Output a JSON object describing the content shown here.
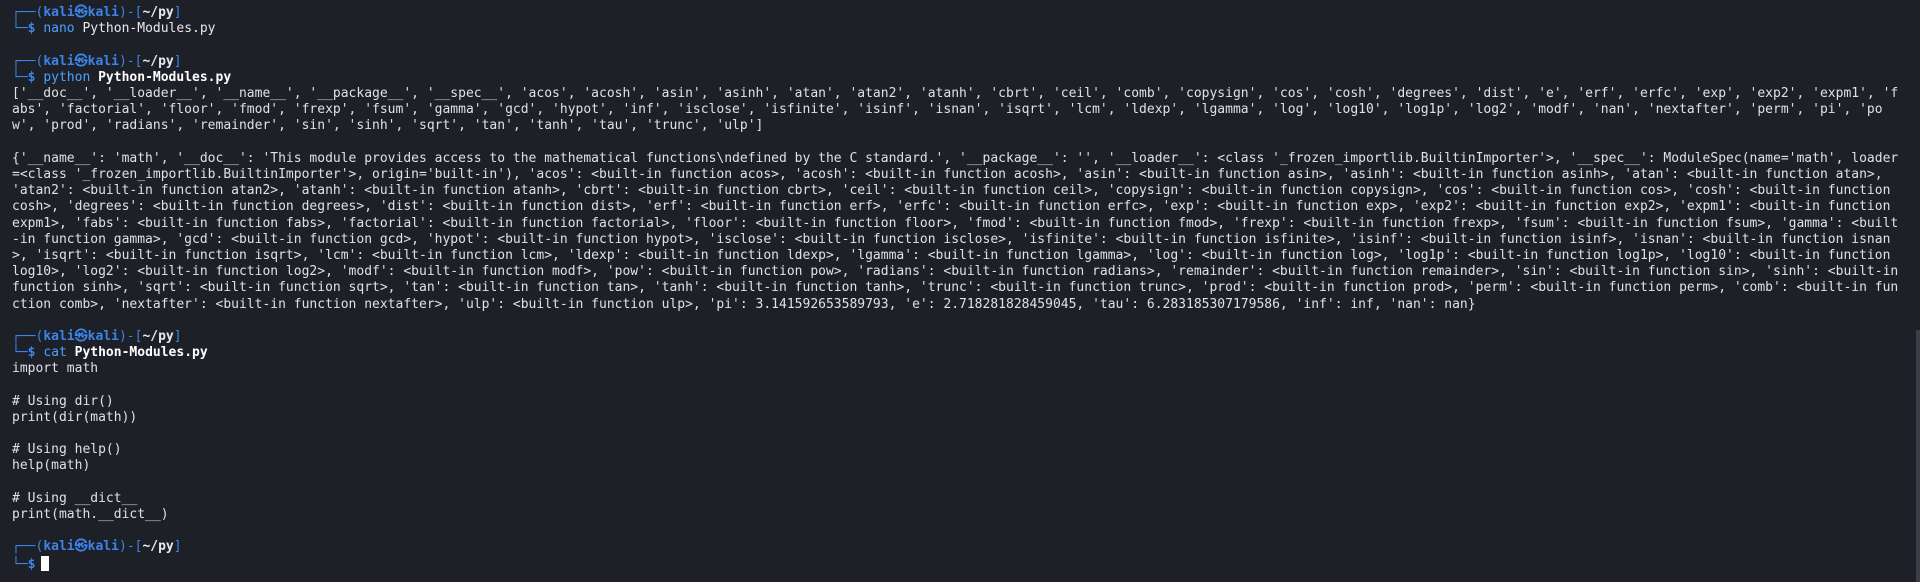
{
  "prompt": {
    "frame_top_open": "┌──(",
    "user": "kali",
    "at": "㉿",
    "host": "kali",
    "frame_mid": ")-[",
    "cwd": "~/py",
    "frame_close": "]",
    "frame_bottom": "└─",
    "dollar": "$"
  },
  "commands": [
    {
      "cmd": "nano",
      "arg": "Python-Modules.py"
    },
    {
      "cmd": "python",
      "arg": "Python-Modules.py"
    },
    {
      "cmd": "cat",
      "arg": "Python-Modules.py"
    }
  ],
  "output": {
    "dir_output": "['__doc__', '__loader__', '__name__', '__package__', '__spec__', 'acos', 'acosh', 'asin', 'asinh', 'atan', 'atan2', 'atanh', 'cbrt', 'ceil', 'comb', 'copysign', 'cos', 'cosh', 'degrees', 'dist', 'e', 'erf', 'erfc', 'exp', 'exp2', 'expm1', 'fabs', 'factorial', 'floor', 'fmod', 'frexp', 'fsum', 'gamma', 'gcd', 'hypot', 'inf', 'isclose', 'isfinite', 'isinf', 'isnan', 'isqrt', 'lcm', 'ldexp', 'lgamma', 'log', 'log10', 'log1p', 'log2', 'modf', 'nan', 'nextafter', 'perm', 'pi', 'pow', 'prod', 'radians', 'remainder', 'sin', 'sinh', 'sqrt', 'tan', 'tanh', 'tau', 'trunc', 'ulp']",
    "dict_output": "{'__name__': 'math', '__doc__': 'This module provides access to the mathematical functions\\ndefined by the C standard.', '__package__': '', '__loader__': <class '_frozen_importlib.BuiltinImporter'>, '__spec__': ModuleSpec(name='math', loader=<class '_frozen_importlib.BuiltinImporter'>, origin='built-in'), 'acos': <built-in function acos>, 'acosh': <built-in function acosh>, 'asin': <built-in function asin>, 'asinh': <built-in function asinh>, 'atan': <built-in function atan>, 'atan2': <built-in function atan2>, 'atanh': <built-in function atanh>, 'cbrt': <built-in function cbrt>, 'ceil': <built-in function ceil>, 'copysign': <built-in function copysign>, 'cos': <built-in function cos>, 'cosh': <built-in function cosh>, 'degrees': <built-in function degrees>, 'dist': <built-in function dist>, 'erf': <built-in function erf>, 'erfc': <built-in function erfc>, 'exp': <built-in function exp>, 'exp2': <built-in function exp2>, 'expm1': <built-in function expm1>, 'fabs': <built-in function fabs>, 'factorial': <built-in function factorial>, 'floor': <built-in function floor>, 'fmod': <built-in function fmod>, 'frexp': <built-in function frexp>, 'fsum': <built-in function fsum>, 'gamma': <built-in function gamma>, 'gcd': <built-in function gcd>, 'hypot': <built-in function hypot>, 'isclose': <built-in function isclose>, 'isfinite': <built-in function isfinite>, 'isinf': <built-in function isinf>, 'isnan': <built-in function isnan>, 'isqrt': <built-in function isqrt>, 'lcm': <built-in function lcm>, 'ldexp': <built-in function ldexp>, 'lgamma': <built-in function lgamma>, 'log': <built-in function log>, 'log1p': <built-in function log1p>, 'log10': <built-in function log10>, 'log2': <built-in function log2>, 'modf': <built-in function modf>, 'pow': <built-in function pow>, 'radians': <built-in function radians>, 'remainder': <built-in function remainder>, 'sin': <built-in function sin>, 'sinh': <built-in function sinh>, 'sqrt': <built-in function sqrt>, 'tan': <built-in function tan>, 'tanh': <built-in function tanh>, 'trunc': <built-in function trunc>, 'prod': <built-in function prod>, 'perm': <built-in function perm>, 'comb': <built-in function comb>, 'nextafter': <built-in function nextafter>, 'ulp': <built-in function ulp>, 'pi': 3.141592653589793, 'e': 2.718281828459045, 'tau': 6.283185307179586, 'inf': inf, 'nan': nan}"
  },
  "file_contents": [
    "import math",
    "",
    "# Using dir()",
    "print(dir(math))",
    "",
    "# Using help()",
    "help(math)",
    "",
    "# Using __dict__",
    "print(math.__dict__)"
  ],
  "colors": {
    "background": "#1e2028",
    "prompt_blue": "#3b84e8",
    "command_blue": "#4aa0ff",
    "text": "#dfe1e6"
  }
}
